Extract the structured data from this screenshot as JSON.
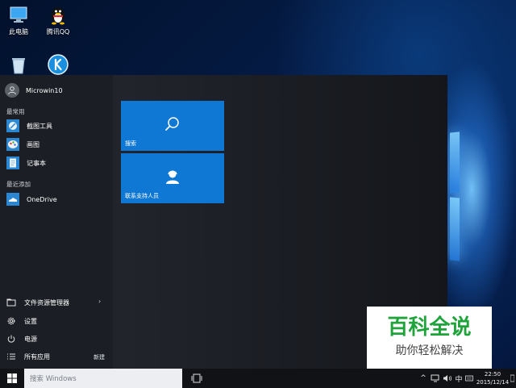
{
  "desktop": {
    "icons": [
      {
        "label": "此电脑",
        "icon": "computer-icon"
      },
      {
        "label": "腾讯QQ",
        "icon": "qq-penguin-icon"
      },
      {
        "label": "",
        "icon": "recycle-bin-icon"
      },
      {
        "label": "",
        "icon": "k-app-icon"
      }
    ]
  },
  "start_menu": {
    "user_name": "Microwin10",
    "most_used_header": "最常用",
    "most_used": [
      {
        "label": "截图工具",
        "icon": "snipping-tool-icon"
      },
      {
        "label": "画图",
        "icon": "paint-icon"
      },
      {
        "label": "记事本",
        "icon": "notepad-icon"
      }
    ],
    "recent_header": "最近添加",
    "recent": [
      {
        "label": "OneDrive",
        "icon": "onedrive-icon"
      }
    ],
    "bottom": {
      "file_explorer": "文件资源管理器",
      "settings": "设置",
      "power": "电源",
      "all_apps": "所有应用",
      "new_badge": "新建"
    },
    "tiles": [
      {
        "label": "搜索",
        "icon": "search-icon"
      },
      {
        "label": "联系支持人员",
        "icon": "contact-support-icon"
      }
    ]
  },
  "watermark": {
    "title": "百科全说",
    "subtitle": "助你轻松解决"
  },
  "taskbar": {
    "search_placeholder": "搜索 Windows",
    "language": "中",
    "time": "22:50",
    "date": "2015/12/14"
  },
  "colors": {
    "tile_blue": "#0e78d4",
    "watermark_green": "#1fa43b"
  }
}
